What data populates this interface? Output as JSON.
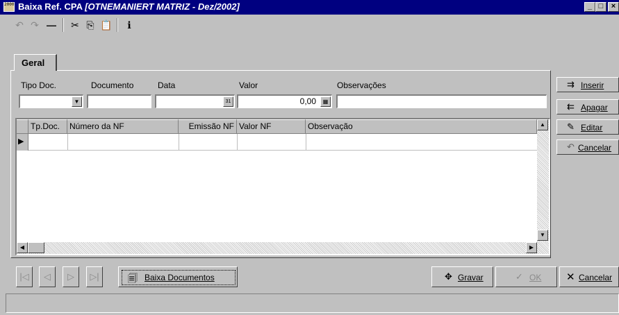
{
  "window": {
    "app_icon_text": "2000",
    "title": "Baixa Ref. CPA",
    "subtitle": "[OTNEMANIERT MATRIZ - Dez/2002]",
    "minimize_glyph": "_",
    "maximize_glyph": "□",
    "close_glyph": "×"
  },
  "toolbar": {
    "undo_icon": "↶",
    "redo_icon": "↷",
    "delete_icon": "—",
    "cut_icon": "✂",
    "copy_icon": "⎘",
    "paste_icon": "📋",
    "info_icon": "ℹ"
  },
  "tabs": [
    {
      "label": "Geral"
    }
  ],
  "form": {
    "tipo_doc_label": "Tipo Doc.",
    "documento_label": "Documento",
    "data_label": "Data",
    "valor_label": "Valor",
    "valor_value": "0,00",
    "observacoes_label": "Observações"
  },
  "grid": {
    "columns": [
      "Tp.Doc.",
      "Número da NF",
      "Emissão NF",
      "Valor NF",
      "Observação"
    ],
    "rows": [],
    "current_row_marker": "▶"
  },
  "side_buttons": {
    "inserir": "Inserir",
    "apagar": "Apagar",
    "editar": "Editar",
    "cancelar": "Cancelar"
  },
  "bottom": {
    "nav_first": "|◁",
    "nav_prev": "◁",
    "nav_next": "▷",
    "nav_last": "▷|",
    "baixa_documentos": "Baixa Documentos",
    "gravar": "Gravar",
    "ok": "OK",
    "cancelar": "Cancelar"
  },
  "colors": {
    "titlebar": "#000080",
    "face": "#c0c0c0",
    "disabled_text": "#8a8a8a"
  }
}
